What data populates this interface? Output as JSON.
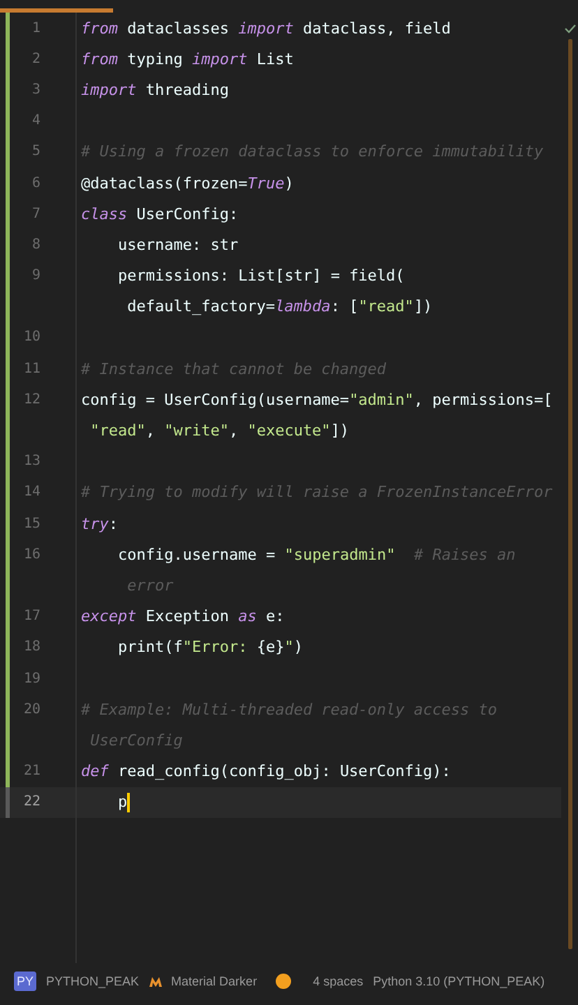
{
  "editor": {
    "lines": [
      {
        "number": "1",
        "modified": true,
        "current": false,
        "rows": [
          {
            "segments": [
              {
                "kind": "keyword",
                "text": "from"
              },
              {
                "kind": "name",
                "text": " dataclasses "
              },
              {
                "kind": "keyword",
                "text": "import"
              },
              {
                "kind": "name",
                "text": " dataclass, field"
              }
            ]
          }
        ]
      },
      {
        "number": "2",
        "modified": true,
        "current": false,
        "rows": [
          {
            "segments": [
              {
                "kind": "keyword",
                "text": "from"
              },
              {
                "kind": "name",
                "text": " typing "
              },
              {
                "kind": "keyword",
                "text": "import"
              },
              {
                "kind": "name",
                "text": " List"
              }
            ]
          }
        ]
      },
      {
        "number": "3",
        "modified": true,
        "current": false,
        "rows": [
          {
            "segments": [
              {
                "kind": "keyword",
                "text": "import"
              },
              {
                "kind": "name",
                "text": " threading"
              }
            ]
          }
        ]
      },
      {
        "number": "4",
        "modified": true,
        "current": false,
        "rows": [
          {}
        ]
      },
      {
        "number": "5",
        "modified": true,
        "current": false,
        "rows": [
          {
            "segments": [
              {
                "kind": "comment",
                "text": "# Using a frozen dataclass to enforce immutability"
              }
            ]
          }
        ]
      },
      {
        "number": "6",
        "modified": true,
        "current": false,
        "rows": [
          {
            "segments": [
              {
                "kind": "name",
                "text": "@dataclass(frozen="
              },
              {
                "kind": "keyword",
                "text": "True"
              },
              {
                "kind": "name",
                "text": ")"
              }
            ]
          }
        ]
      },
      {
        "number": "7",
        "modified": true,
        "current": false,
        "rows": [
          {
            "segments": [
              {
                "kind": "keyword",
                "text": "class"
              },
              {
                "kind": "name",
                "text": " UserConfig:"
              }
            ]
          }
        ]
      },
      {
        "number": "8",
        "modified": true,
        "current": false,
        "indented": true,
        "rows": [
          {
            "segments": [
              {
                "kind": "name",
                "text": "username: str"
              }
            ]
          }
        ]
      },
      {
        "number": "9",
        "modified": true,
        "current": false,
        "indented": true,
        "rows": [
          {
            "segments": [
              {
                "kind": "name",
                "text": "permissions: List[str] = field("
              }
            ]
          },
          {
            "segments": [
              {
                "kind": "name",
                "text": "default_factory="
              },
              {
                "kind": "keyword",
                "text": "lambda"
              },
              {
                "kind": "name",
                "text": ": ["
              },
              {
                "kind": "string",
                "text": "\"read\""
              },
              {
                "kind": "name",
                "text": "])"
              }
            ]
          }
        ]
      },
      {
        "number": "10",
        "modified": true,
        "current": false,
        "rows": [
          {}
        ]
      },
      {
        "number": "11",
        "modified": true,
        "current": false,
        "rows": [
          {
            "segments": [
              {
                "kind": "comment",
                "text": "# Instance that cannot be changed"
              }
            ]
          }
        ]
      },
      {
        "number": "12",
        "modified": true,
        "current": false,
        "rows": [
          {
            "segments": [
              {
                "kind": "name",
                "text": "config = UserConfig(username="
              },
              {
                "kind": "string",
                "text": "\"admin\""
              },
              {
                "kind": "name",
                "text": ", permissions=["
              }
            ]
          },
          {
            "segments": [
              {
                "kind": "string",
                "text": "\"read\""
              },
              {
                "kind": "name",
                "text": ", "
              },
              {
                "kind": "string",
                "text": "\"write\""
              },
              {
                "kind": "name",
                "text": ", "
              },
              {
                "kind": "string",
                "text": "\"execute\""
              },
              {
                "kind": "name",
                "text": "])"
              }
            ]
          }
        ]
      },
      {
        "number": "13",
        "modified": true,
        "current": false,
        "rows": [
          {}
        ]
      },
      {
        "number": "14",
        "modified": true,
        "current": false,
        "rows": [
          {
            "segments": [
              {
                "kind": "comment",
                "text": "# Trying to modify will raise a FrozenInstanceError"
              }
            ]
          }
        ]
      },
      {
        "number": "15",
        "modified": true,
        "current": false,
        "rows": [
          {
            "segments": [
              {
                "kind": "keyword",
                "text": "try"
              },
              {
                "kind": "name",
                "text": ":"
              }
            ]
          }
        ]
      },
      {
        "number": "16",
        "modified": true,
        "current": false,
        "indented": true,
        "rows": [
          {
            "segments": [
              {
                "kind": "name",
                "text": "config.username = "
              },
              {
                "kind": "string",
                "text": "\"superadmin\""
              },
              {
                "kind": "comment",
                "text": "  # Raises an"
              }
            ]
          },
          {
            "segments": [
              {
                "kind": "comment",
                "text": "error"
              }
            ]
          }
        ]
      },
      {
        "number": "17",
        "modified": true,
        "current": false,
        "rows": [
          {
            "segments": [
              {
                "kind": "keyword",
                "text": "except"
              },
              {
                "kind": "name",
                "text": " Exception "
              },
              {
                "kind": "keyword",
                "text": "as"
              },
              {
                "kind": "name",
                "text": " e:"
              }
            ]
          }
        ]
      },
      {
        "number": "18",
        "modified": true,
        "current": false,
        "indented": true,
        "rows": [
          {
            "segments": [
              {
                "kind": "name",
                "text": "print(f"
              },
              {
                "kind": "string",
                "text": "\"Error: "
              },
              {
                "kind": "name",
                "text": "{e}"
              },
              {
                "kind": "string",
                "text": "\""
              },
              {
                "kind": "name",
                "text": ")"
              }
            ]
          }
        ]
      },
      {
        "number": "19",
        "modified": true,
        "current": false,
        "rows": [
          {}
        ]
      },
      {
        "number": "20",
        "modified": true,
        "current": false,
        "rows": [
          {
            "segments": [
              {
                "kind": "comment",
                "text": "# Example: Multi-threaded read-only access to"
              }
            ]
          },
          {
            "segments": [
              {
                "kind": "comment",
                "text": "UserConfig"
              }
            ]
          }
        ]
      },
      {
        "number": "21",
        "modified": true,
        "current": false,
        "rows": [
          {
            "segments": [
              {
                "kind": "keyword",
                "text": "def"
              },
              {
                "kind": "name",
                "text": " read_config(config_obj: UserConfig):"
              }
            ]
          }
        ]
      },
      {
        "number": "22",
        "modified": false,
        "current": true,
        "indented": true,
        "rows": [
          {
            "segments": [
              {
                "kind": "name",
                "text": "p"
              }
            ]
          }
        ]
      }
    ]
  },
  "status_bar": {
    "project_badge": "PY",
    "project": "PYTHON_PEAK",
    "theme": "Material Darker",
    "indent": "4 spaces",
    "interpreter": "Python 3.10 (PYTHON_PEAK)"
  }
}
